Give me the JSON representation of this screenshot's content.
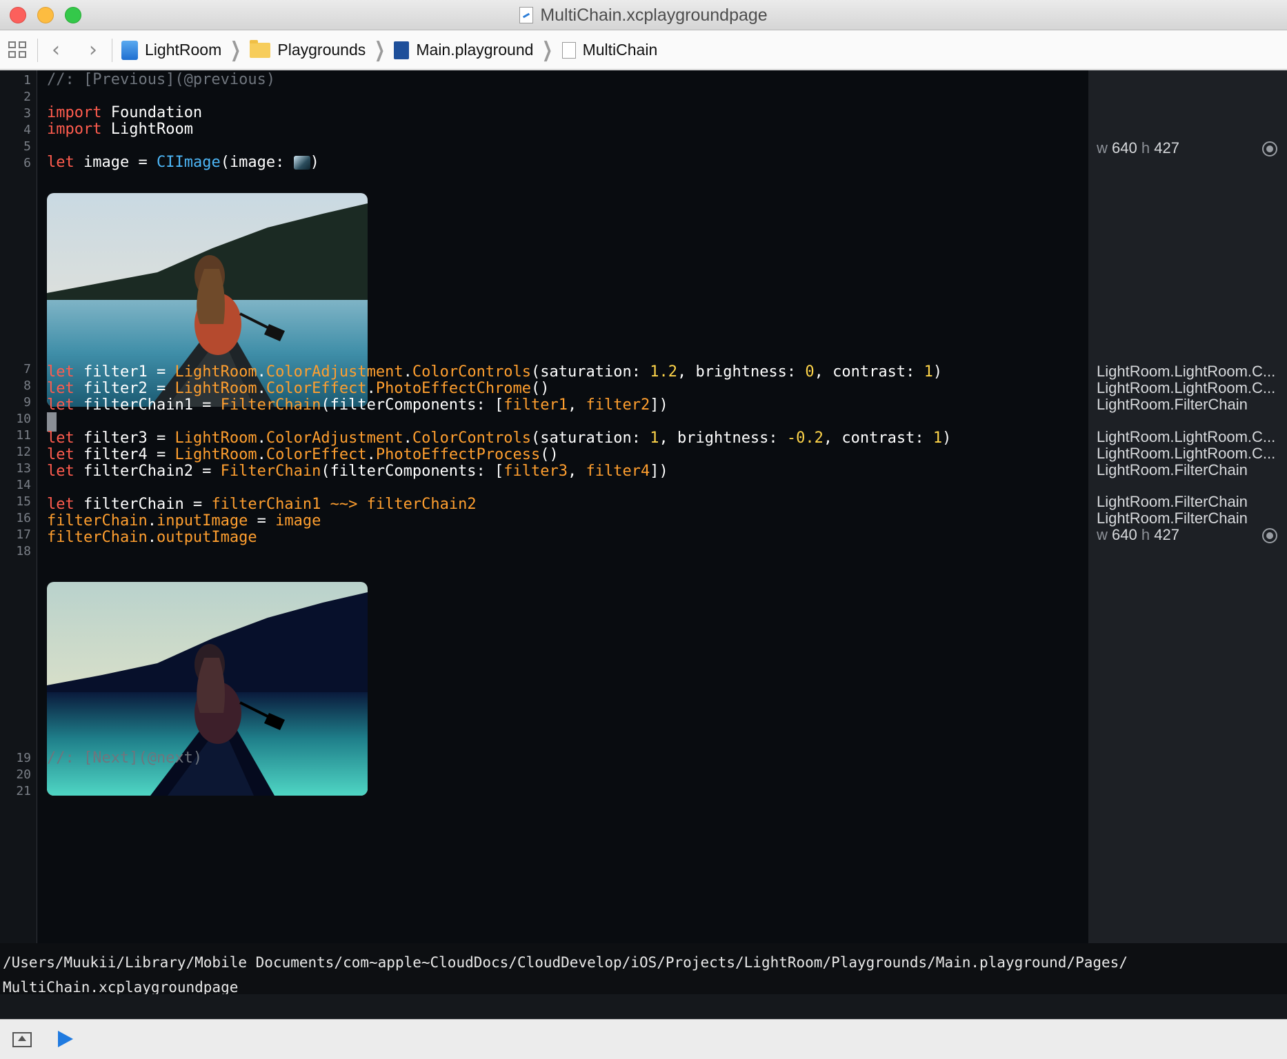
{
  "window": {
    "title": "MultiChain.xcplaygroundpage"
  },
  "jumpbar": {
    "crumbs": [
      {
        "label": "LightRoom",
        "icon": "project-icon"
      },
      {
        "label": "Playgrounds",
        "icon": "folder-icon"
      },
      {
        "label": "Main.playground",
        "icon": "playground-icon"
      },
      {
        "label": "MultiChain",
        "icon": "playground-page-icon"
      }
    ]
  },
  "editor": {
    "line_numbers": [
      "1",
      "2",
      "3",
      "4",
      "5",
      "6",
      "7",
      "8",
      "9",
      "10",
      "11",
      "12",
      "13",
      "14",
      "15",
      "16",
      "17",
      "18",
      "19",
      "20",
      "21"
    ],
    "lines": {
      "l1": "//: [Previous](@previous)",
      "l3_kw": "import",
      "l3_rest": " Foundation",
      "l4_kw": "import",
      "l4_rest": " LightRoom",
      "l6_kw": "let",
      "l6_a": " image = ",
      "l6_cl": "CIImage",
      "l6_b": "(image: ",
      "l6_c": ")",
      "l8": {
        "kw": "let",
        "a": " filter1 = ",
        "t1": "LightRoom",
        ".": ".",
        "t2": "ColorAdjustment",
        "t3": "ColorControls",
        "b": "(saturation: ",
        "n1": "1.2",
        "c": ", brightness: ",
        "n2": "0",
        "d": ", contrast: ",
        "n3": "1",
        "e": ")"
      },
      "l9": {
        "kw": "let",
        "a": " filter2 = ",
        "t1": "LightRoom",
        "t2": "ColorEffect",
        "t3": "PhotoEffectChrome",
        "e": "()"
      },
      "l10": {
        "kw": "let",
        "a": " filterChain1 = ",
        "t1": "FilterChain",
        "b": "(filterComponents: [",
        "p1": "filter1",
        "c": ", ",
        "p2": "filter2",
        "e": "])"
      },
      "l12": {
        "kw": "let",
        "a": " filter3 = ",
        "t1": "LightRoom",
        "t2": "ColorAdjustment",
        "t3": "ColorControls",
        "b": "(saturation: ",
        "n1": "1",
        "c": ", brightness: ",
        "n2": "-0.2",
        "d": ", contrast: ",
        "n3": "1",
        "e": ")"
      },
      "l13": {
        "kw": "let",
        "a": " filter4 = ",
        "t1": "LightRoom",
        "t2": "ColorEffect",
        "t3": "PhotoEffectProcess",
        "e": "()"
      },
      "l14": {
        "kw": "let",
        "a": " filterChain2 = ",
        "t1": "FilterChain",
        "b": "(filterComponents: [",
        "p1": "filter3",
        "c": ", ",
        "p2": "filter4",
        "e": "])"
      },
      "l16": {
        "kw": "let",
        "a": " filterChain = ",
        "p1": "filterChain1",
        "op": " ~~> ",
        "p2": "filterChain2"
      },
      "l17": {
        "p1": "filterChain",
        "dot": ".",
        "p2": "inputImage",
        "a": " = ",
        "p3": "image"
      },
      "l18": {
        "p1": "filterChain",
        "dot": ".",
        "p2": "outputImage"
      },
      "l20": "//: [Next](@next)"
    }
  },
  "results": {
    "r6": {
      "w": "w",
      "wv": "640",
      "h": "h",
      "hv": "427"
    },
    "r8": "LightRoom.LightRoom.C...",
    "r9": "LightRoom.LightRoom.C...",
    "r10": "LightRoom.FilterChain",
    "r12": "LightRoom.LightRoom.C...",
    "r13": "LightRoom.LightRoom.C...",
    "r14": "LightRoom.FilterChain",
    "r16": "LightRoom.FilterChain",
    "r17": "LightRoom.FilterChain",
    "r18": {
      "w": "w",
      "wv": "640",
      "h": "h",
      "hv": "427"
    }
  },
  "console": {
    "text": "/Users/Muukii/Library/Mobile Documents/com~apple~CloudDocs/CloudDevelop/iOS/Projects/LightRoom/Playgrounds/Main.playground/Pages/\nMultiChain.xcplaygroundpage"
  },
  "colors": {
    "keyword": "#ff5c4e",
    "type": "#ff9f2f",
    "class": "#4db6f6",
    "number": "#ffd54a",
    "comment": "#6f757d",
    "run": "#1f7ae0"
  }
}
